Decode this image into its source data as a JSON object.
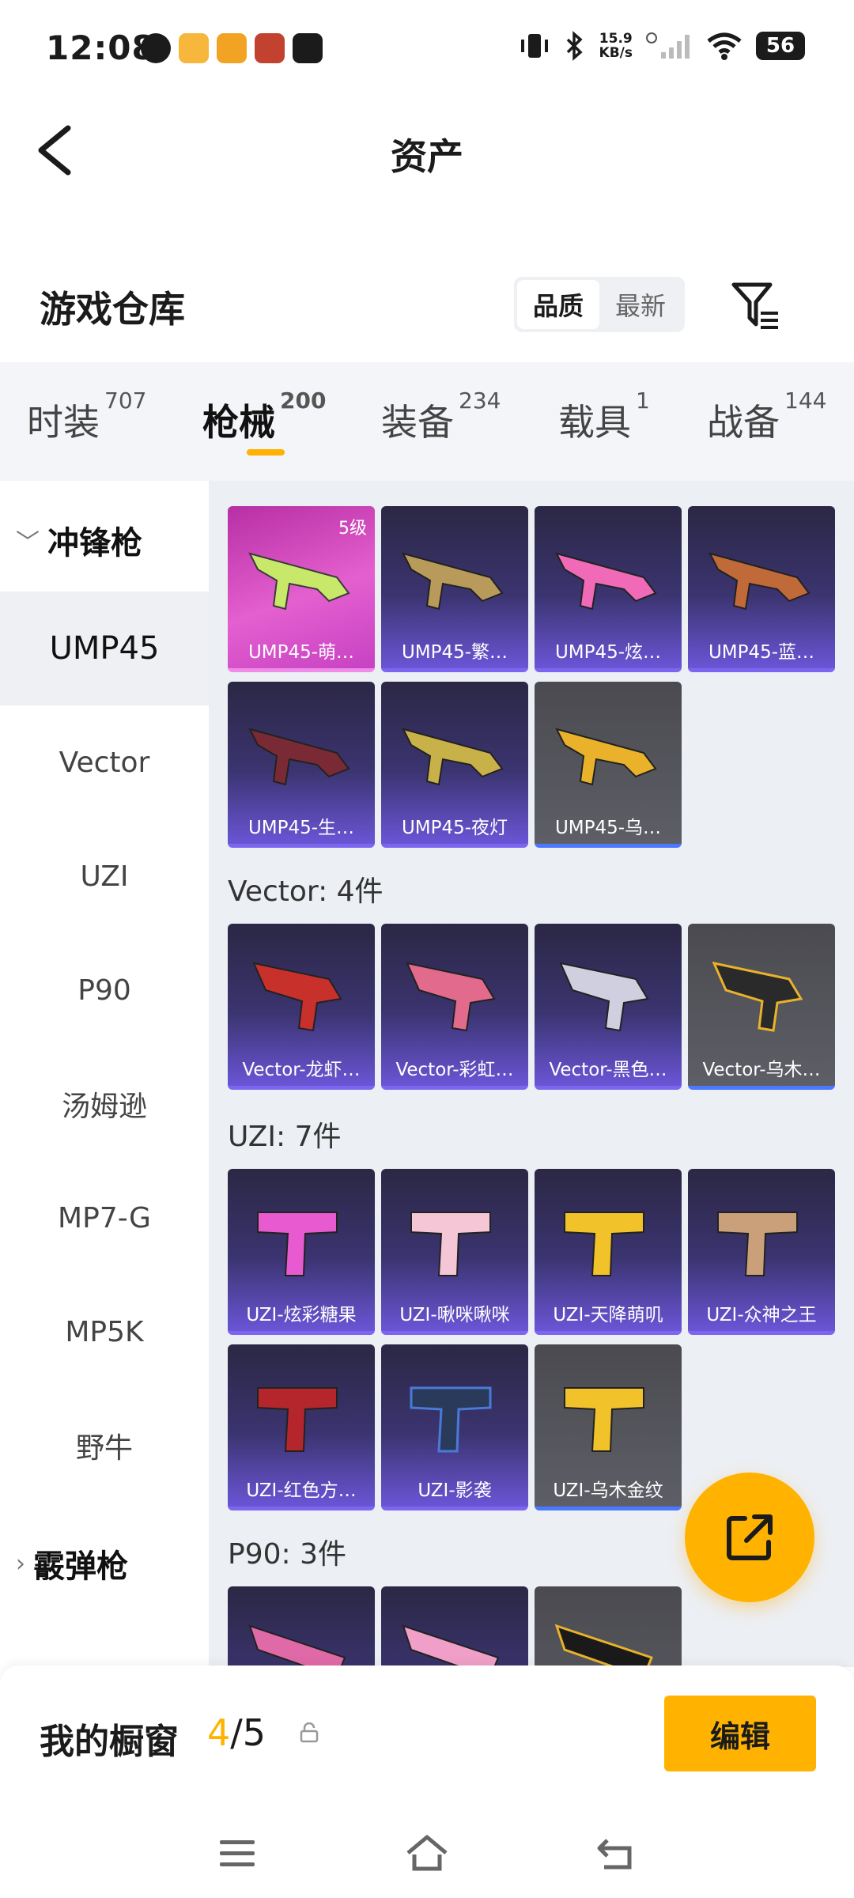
{
  "status_bar": {
    "time": "12:08",
    "net_speed_value": "15.9",
    "net_speed_unit": "KB/s",
    "battery": "56"
  },
  "header": {
    "title": "资产"
  },
  "warehouse": {
    "title": "游戏仓库",
    "sort_options": [
      "品质",
      "最新"
    ],
    "selected_sort": "品质"
  },
  "tabs": [
    {
      "label": "时装",
      "count": "707"
    },
    {
      "label": "枪械",
      "count": "200",
      "active": true
    },
    {
      "label": "装备",
      "count": "234"
    },
    {
      "label": "载具",
      "count": "1"
    },
    {
      "label": "战备",
      "count": "144"
    }
  ],
  "sidebar": {
    "category_smg": "冲锋枪",
    "items": [
      "UMP45",
      "Vector",
      "UZI",
      "P90",
      "汤姆逊",
      "MP7-G",
      "MP5K",
      "野牛"
    ],
    "selected": "UMP45",
    "category_shotgun": "霰弹枪"
  },
  "groups": {
    "vector_title": "Vector: 4件",
    "uzi_title": "UZI: 7件",
    "p90_title": "P90: 3件"
  },
  "cards": {
    "ump45": [
      "UMP45-萌…",
      "UMP45-繁…",
      "UMP45-炫…",
      "UMP45-蓝…",
      "UMP45-生…",
      "UMP45-夜灯",
      "UMP45-乌…"
    ],
    "ump45_level": "5级",
    "vector": [
      "Vector-龙虾…",
      "Vector-彩虹…",
      "Vector-黑色…",
      "Vector-乌木…"
    ],
    "uzi": [
      "UZI-炫彩糖果",
      "UZI-啾咪啾咪",
      "UZI-天降萌叽",
      "UZI-众神之王",
      "UZI-红色方…",
      "UZI-影袭",
      "UZI-乌木金纹"
    ]
  },
  "showcase": {
    "label": "我的橱窗",
    "current": "4",
    "total": "/5",
    "edit_label": "编辑"
  },
  "colors": {
    "accent": "#ffb300",
    "card_purple": "#6a55d6",
    "card_pink": "#e45fcf",
    "card_gray": "#5e5e66"
  }
}
